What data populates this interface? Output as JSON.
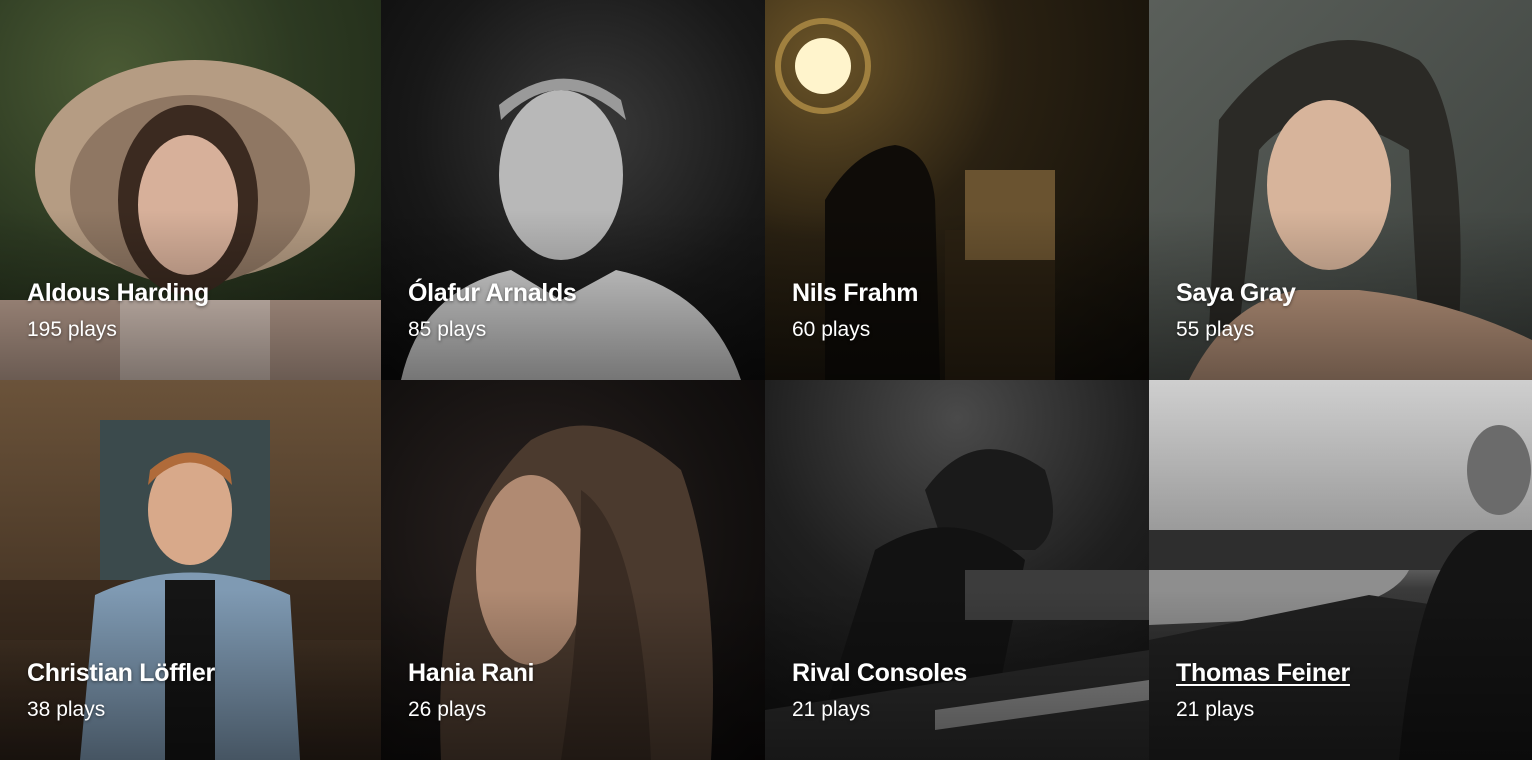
{
  "artists": [
    {
      "name": "Aldous Harding",
      "plays": "195 plays"
    },
    {
      "name": "Ólafur Arnalds",
      "plays": "85 plays"
    },
    {
      "name": "Nils Frahm",
      "plays": "60 plays"
    },
    {
      "name": "Saya Gray",
      "plays": "55 plays"
    },
    {
      "name": "Christian Löffler",
      "plays": "38 plays"
    },
    {
      "name": "Hania Rani",
      "plays": "26 plays"
    },
    {
      "name": "Rival Consoles",
      "plays": "21 plays"
    },
    {
      "name": "Thomas Feiner",
      "plays": "21 plays"
    }
  ]
}
